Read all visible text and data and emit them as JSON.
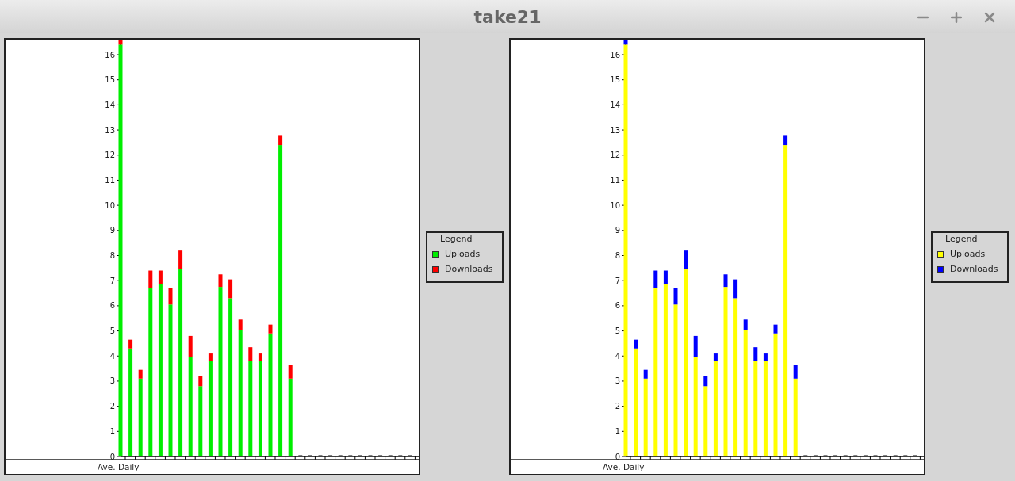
{
  "window": {
    "title": "take21"
  },
  "charts": [
    {
      "chart_data": {
        "type": "bar",
        "stacked": true,
        "xlabel": "Ave. Daily",
        "ylim": [
          0,
          16.6
        ],
        "yticks": [
          0,
          1,
          2,
          3,
          4,
          5,
          6,
          7,
          8,
          9,
          10,
          11,
          12,
          13,
          14,
          15,
          16
        ],
        "series": [
          {
            "name": "Uploads",
            "color": "#00ee00",
            "values": [
              16.4,
              4.3,
              3.1,
              6.7,
              6.85,
              6.05,
              7.45,
              3.95,
              2.8,
              3.8,
              6.75,
              6.3,
              5.05,
              3.8,
              3.8,
              4.9,
              12.4,
              3.1,
              0,
              0,
              0,
              0,
              0,
              0,
              0,
              0,
              0,
              0,
              0,
              0
            ]
          },
          {
            "name": "Downloads",
            "color": "#ff0000",
            "values": [
              0.2,
              0.35,
              0.35,
              0.7,
              0.55,
              0.65,
              0.75,
              0.85,
              0.4,
              0.3,
              0.5,
              0.75,
              0.4,
              0.55,
              0.3,
              0.35,
              0.4,
              0.55,
              0,
              0,
              0,
              0,
              0,
              0,
              0,
              0,
              0,
              0,
              0,
              0
            ]
          }
        ]
      },
      "legend": {
        "title": "Legend"
      }
    },
    {
      "chart_data": {
        "type": "bar",
        "stacked": true,
        "xlabel": "Ave. Daily",
        "ylim": [
          0,
          16.6
        ],
        "yticks": [
          0,
          1,
          2,
          3,
          4,
          5,
          6,
          7,
          8,
          9,
          10,
          11,
          12,
          13,
          14,
          15,
          16
        ],
        "series": [
          {
            "name": "Uploads",
            "color": "#ffff00",
            "values": [
              16.4,
              4.3,
              3.1,
              6.7,
              6.85,
              6.05,
              7.45,
              3.95,
              2.8,
              3.8,
              6.75,
              6.3,
              5.05,
              3.8,
              3.8,
              4.9,
              12.4,
              3.1,
              0,
              0,
              0,
              0,
              0,
              0,
              0,
              0,
              0,
              0,
              0,
              0
            ]
          },
          {
            "name": "Downloads",
            "color": "#0000ff",
            "values": [
              0.2,
              0.35,
              0.35,
              0.7,
              0.55,
              0.65,
              0.75,
              0.85,
              0.4,
              0.3,
              0.5,
              0.75,
              0.4,
              0.55,
              0.3,
              0.35,
              0.4,
              0.55,
              0,
              0,
              0,
              0,
              0,
              0,
              0,
              0,
              0,
              0,
              0,
              0
            ]
          }
        ]
      },
      "legend": {
        "title": "Legend"
      }
    }
  ]
}
